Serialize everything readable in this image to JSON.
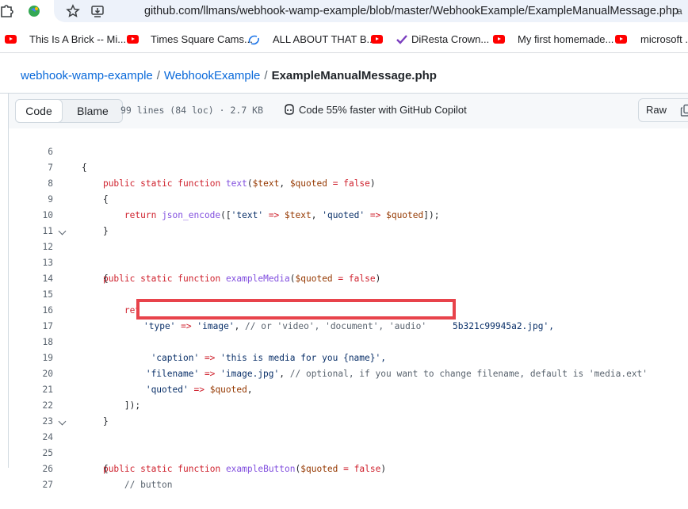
{
  "browser": {
    "url": "github.com/llmans/webhook-wamp-example/blob/master/WebhookExample/ExampleManualMessage.php",
    "bookmarks": [
      "This Is A Brick -- Mi...",
      "Times Square Cams...",
      "ALL ABOUT THAT B...",
      "DiResta Crown...",
      "My first homemade...",
      "microsoft .n"
    ]
  },
  "breadcrumb": {
    "repo": "webhook-wamp-example",
    "separator": "/",
    "folder": "WebhookExample",
    "file": "ExampleManualMessage.php"
  },
  "toolbar": {
    "code_tab": "Code",
    "blame_tab": "Blame",
    "meta": "99 lines (84 loc) · 2.7 KB",
    "copilot": "Code 55% faster with GitHub Copilot",
    "raw": "Raw"
  },
  "code": {
    "lines": [
      {
        "n": "6",
        "fold": false
      },
      {
        "n": "7",
        "fold": false
      },
      {
        "n": "8",
        "fold": false
      },
      {
        "n": "9",
        "fold": false
      },
      {
        "n": "10",
        "fold": false
      },
      {
        "n": "11",
        "fold": false
      },
      {
        "n": "12",
        "fold": true
      },
      {
        "n": "13",
        "fold": false
      },
      {
        "n": "14",
        "fold": false
      },
      {
        "n": "15",
        "fold": false
      },
      {
        "n": "16",
        "fold": false
      },
      {
        "n": "17",
        "fold": false
      },
      {
        "n": "18",
        "fold": false
      },
      {
        "n": "19",
        "fold": false
      },
      {
        "n": "20",
        "fold": false
      },
      {
        "n": "21",
        "fold": false
      },
      {
        "n": "22",
        "fold": false
      },
      {
        "n": "23",
        "fold": false
      },
      {
        "n": "24",
        "fold": true
      },
      {
        "n": "25",
        "fold": false
      },
      {
        "n": "26",
        "fold": false
      },
      {
        "n": "27",
        "fold": false
      }
    ],
    "t": {
      "brace_open": "{",
      "brace_close": "}",
      "public": "public",
      "static": "static",
      "function": "function",
      "fn_text": "text",
      "fn_media": "exampleMedia",
      "fn_button": "exampleButton",
      "v_text": "$text",
      "v_quoted": "$quoted",
      "false": "false",
      "return": "return",
      "json_encode": "json_encode",
      "s_text": "'text'",
      "s_quoted": "'quoted'",
      "l16_tail": "5b321c99945a2.jpg',",
      "s_type": "'type'",
      "s_image": "'image'",
      "c_type": "// or 'video', 'document', 'audio'",
      "s_caption": "'caption'",
      "s_caption_val": "'this is media for you {name}',",
      "s_filename": "'filename'",
      "s_imagejpg": "'image.jpg'",
      "c_filename": "// optional, if you want to change filename, default is 'media.ext'",
      "close_arr": "]);",
      "c_button": "// button"
    }
  }
}
